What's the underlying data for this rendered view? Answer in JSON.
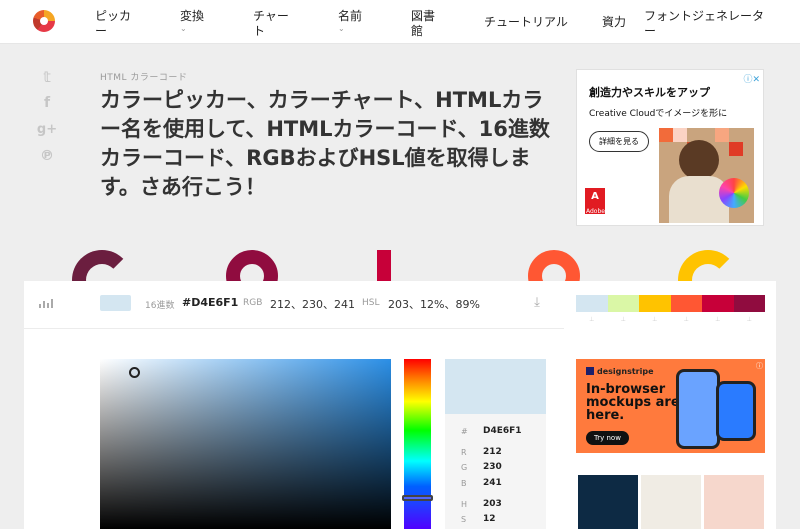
{
  "nav": {
    "items": [
      {
        "label": "ピッカ\nー",
        "has_dropdown": false
      },
      {
        "label": "変換",
        "has_dropdown": true
      },
      {
        "label": "チャー\nト",
        "has_dropdown": false
      },
      {
        "label": "名前",
        "has_dropdown": true
      },
      {
        "label": "図書\n館",
        "has_dropdown": false
      },
      {
        "label": "チュートリアル",
        "has_dropdown": false
      },
      {
        "label": "資力",
        "has_dropdown": false
      },
      {
        "label": "フォントジェネレータ\nー",
        "has_dropdown": false
      }
    ]
  },
  "social": {
    "icons": [
      "twitter-icon",
      "facebook-icon",
      "google-plus-icon",
      "pinterest-icon"
    ],
    "glyphs": [
      "𝕥",
      "f",
      "g+",
      "℗"
    ]
  },
  "header": {
    "kicker": "HTML カラーコード",
    "headline": "カラーピッカー、カラーチャート、HTMLカラー名を使用して、HTMLカラーコード、16進数カラーコード、RGBおよびHSL値を取得します。さあ行こう！"
  },
  "ad_top": {
    "adchoice": "ⓘ✕",
    "title": "創造力やスキルをアップ",
    "subtitle": "Creative Cloudでイメージを形に",
    "button": "詳細を見る",
    "brand": "Adobe",
    "brand_glyph": "A"
  },
  "picker": {
    "hex_label": "16進数",
    "hex_value": "#D4E6F1",
    "rgb_label": "RGB",
    "rgb_value": "212、230、241",
    "hsl_label": "HSL",
    "hsl_value": "203、12%、89%",
    "download_glyph": "⤓",
    "palette": [
      "#D4E6F1",
      "#DAF7A6",
      "#FFC300",
      "#FF5733",
      "#C70039",
      "#900C3F"
    ],
    "palette_tags": [
      "⊥",
      "⊥",
      "⊥",
      "⊥",
      "⊥",
      "⊥"
    ],
    "info": [
      {
        "k": "#",
        "v": "D4E6F1"
      },
      {
        "k": "R",
        "v": "212"
      },
      {
        "k": "G",
        "v": "230"
      },
      {
        "k": "B",
        "v": "241"
      },
      {
        "k": "H",
        "v": "203"
      },
      {
        "k": "S",
        "v": "12"
      }
    ]
  },
  "ad_bottom": {
    "brand": "designstripe",
    "headline": "In-browser mockups are here.",
    "button": "Try now",
    "adchoice": "ⓘ"
  },
  "colors": {
    "deco": [
      "#6b1e3f",
      "#900C3F",
      "#C70039",
      "#FF5733",
      "#FFC300"
    ]
  }
}
